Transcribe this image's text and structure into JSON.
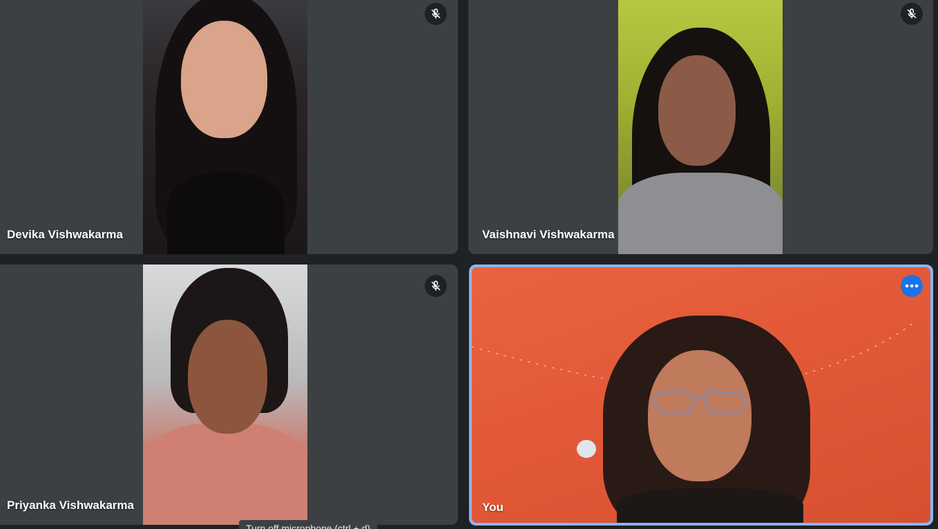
{
  "participants": [
    {
      "name": "Devika Vishwakarma",
      "muted": true
    },
    {
      "name": "Vaishnavi Vishwakarma",
      "muted": true
    },
    {
      "name": "Priyanka Vishwakarma",
      "muted": true
    },
    {
      "name": "You",
      "muted": false,
      "is_self": true
    }
  ],
  "icons": {
    "mic_off": "mic-off-icon",
    "more_options": "more-options-icon"
  },
  "tooltip": {
    "text": "Turn off microphone (ctrl + d)"
  },
  "colors": {
    "background": "#202124",
    "tile": "#3c4043",
    "self_border": "#8ab4f8",
    "more_button": "#1a73e8"
  }
}
